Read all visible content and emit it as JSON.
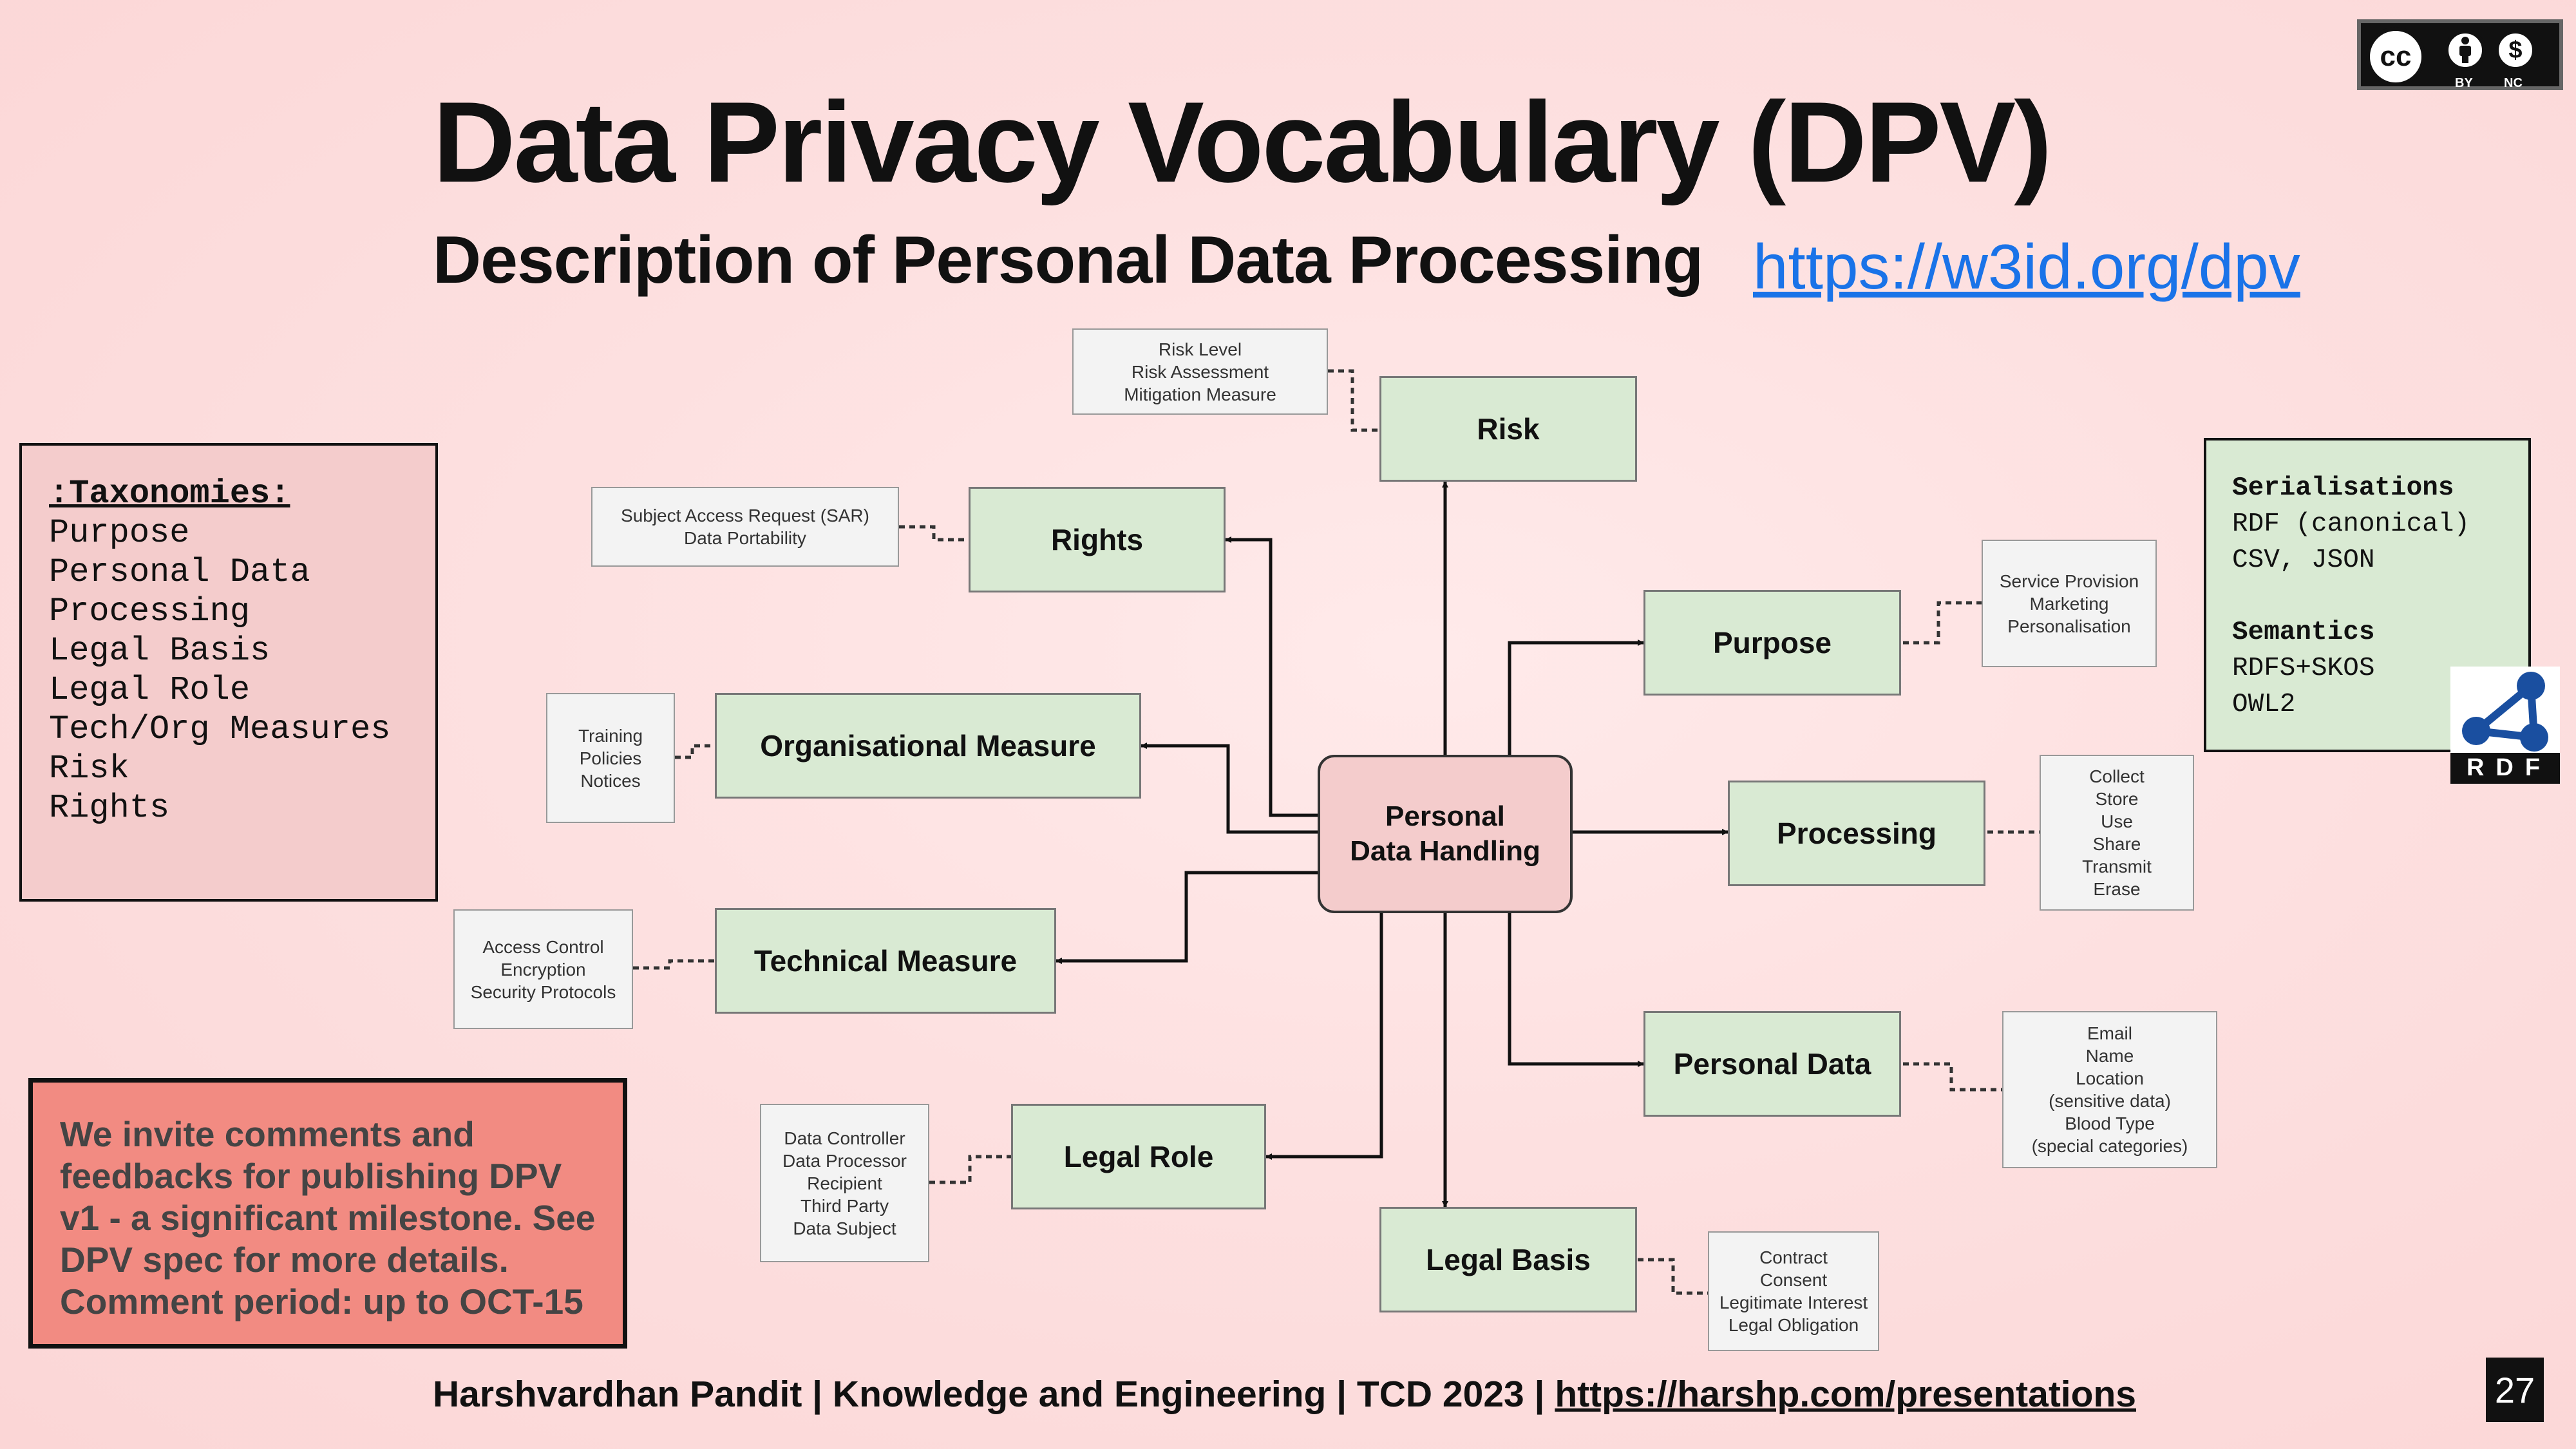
{
  "slide": {
    "title": "Data Privacy Vocabulary (DPV)",
    "subtitle": "Description of Personal Data Processing",
    "link": "https://w3id.org/dpv",
    "page_number": "27",
    "footer_text": "Harshvardhan Pandit | Knowledge and Engineering | TCD 2023 |",
    "footer_link": "https://harshp.com/presentations"
  },
  "license": {
    "by": "BY",
    "nc": "NC",
    "cc": "cc"
  },
  "taxonomies": {
    "heading": ":Taxonomies:",
    "items": [
      "Purpose",
      "Personal Data",
      "Processing",
      "Legal Basis",
      "Legal Role",
      "Tech/Org Measures",
      "Risk",
      "Rights"
    ]
  },
  "serialisations": {
    "heading": "Serialisations",
    "items": [
      "RDF (canonical)",
      "CSV, JSON"
    ],
    "semantics_heading": "Semantics",
    "semantics_items": [
      "RDFS+SKOS",
      "OWL2"
    ],
    "rdf_logo": "RDF"
  },
  "invite": {
    "text": "We invite comments and feedbacks for publishing DPV v1 - a significant milestone. See DPV spec for more details. Comment period: up to OCT-15"
  },
  "diagram": {
    "center": "Personal\nData Handling",
    "nodes": {
      "risk": "Risk",
      "rights": "Rights",
      "org_measure": "Organisational Measure",
      "tech_measure": "Technical Measure",
      "legal_role": "Legal Role",
      "legal_basis": "Legal Basis",
      "purpose": "Purpose",
      "processing": "Processing",
      "personal_data": "Personal Data"
    },
    "notes": {
      "risk": "Risk Level\nRisk Assessment\nMitigation Measure",
      "rights": "Subject Access Request (SAR)\nData Portability",
      "org_measure": "Training\nPolicies\nNotices",
      "tech_measure": "Access Control\nEncryption\nSecurity Protocols",
      "legal_role": "Data Controller\nData Processor\nRecipient\nThird Party\nData Subject",
      "legal_basis": "Contract\nConsent\nLegitimate Interest\nLegal Obligation",
      "purpose": "Service Provision\nMarketing\nPersonalisation",
      "processing": "Collect\nStore\nUse\nShare\nTransmit\nErase",
      "personal_data": "Email\nName\nLocation\n(sensitive data)\nBlood Type\n(special categories)"
    }
  }
}
